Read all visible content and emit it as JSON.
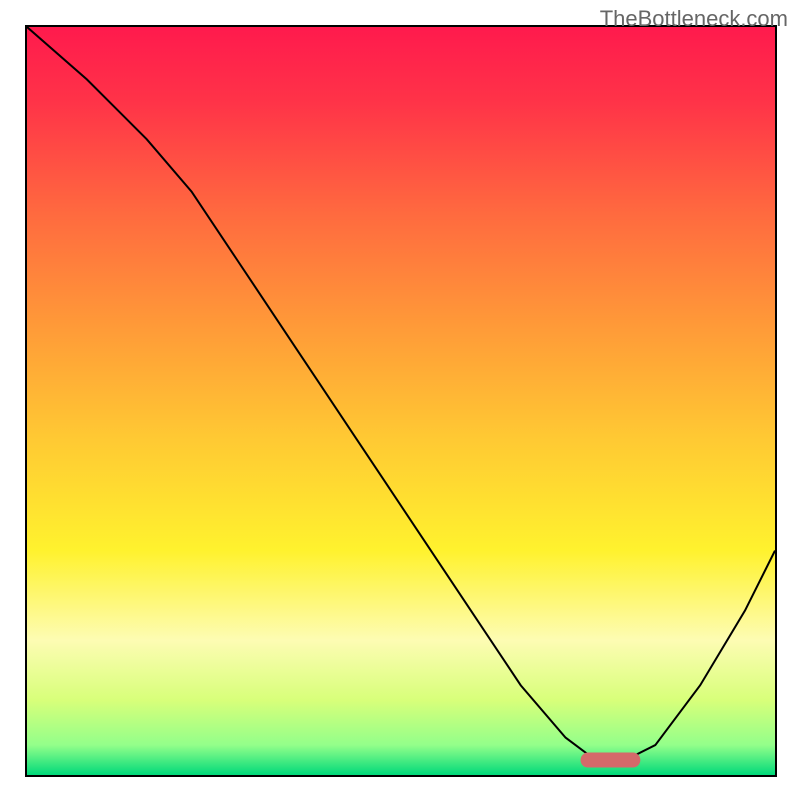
{
  "watermark": "TheBottleneck.com",
  "chart_data": {
    "type": "line",
    "title": "",
    "xlabel": "",
    "ylabel": "",
    "xlim": [
      0,
      100
    ],
    "ylim": [
      0,
      100
    ],
    "grid": false,
    "background": {
      "type": "vertical-gradient",
      "stops": [
        {
          "offset": 0,
          "color": "#ff1a4d"
        },
        {
          "offset": 10,
          "color": "#ff3348"
        },
        {
          "offset": 25,
          "color": "#ff6a3f"
        },
        {
          "offset": 40,
          "color": "#ff9a38"
        },
        {
          "offset": 55,
          "color": "#ffc933"
        },
        {
          "offset": 70,
          "color": "#fff22e"
        },
        {
          "offset": 82,
          "color": "#fdfcb3"
        },
        {
          "offset": 90,
          "color": "#d8ff7a"
        },
        {
          "offset": 96,
          "color": "#93ff8a"
        },
        {
          "offset": 100,
          "color": "#00d97a"
        }
      ]
    },
    "series": [
      {
        "name": "curve",
        "stroke": "#000000",
        "points": [
          {
            "x": 0,
            "y": 100
          },
          {
            "x": 8,
            "y": 93
          },
          {
            "x": 16,
            "y": 85
          },
          {
            "x": 22,
            "y": 78
          },
          {
            "x": 28,
            "y": 69
          },
          {
            "x": 36,
            "y": 57
          },
          {
            "x": 44,
            "y": 45
          },
          {
            "x": 52,
            "y": 33
          },
          {
            "x": 60,
            "y": 21
          },
          {
            "x": 66,
            "y": 12
          },
          {
            "x": 72,
            "y": 5
          },
          {
            "x": 76,
            "y": 2
          },
          {
            "x": 80,
            "y": 2
          },
          {
            "x": 84,
            "y": 4
          },
          {
            "x": 90,
            "y": 12
          },
          {
            "x": 96,
            "y": 22
          },
          {
            "x": 100,
            "y": 30
          }
        ]
      }
    ],
    "marker": {
      "name": "bottleneck-marker",
      "color": "#d46a6a",
      "x_start": 74,
      "x_end": 82,
      "y": 2,
      "thickness": 2
    }
  }
}
